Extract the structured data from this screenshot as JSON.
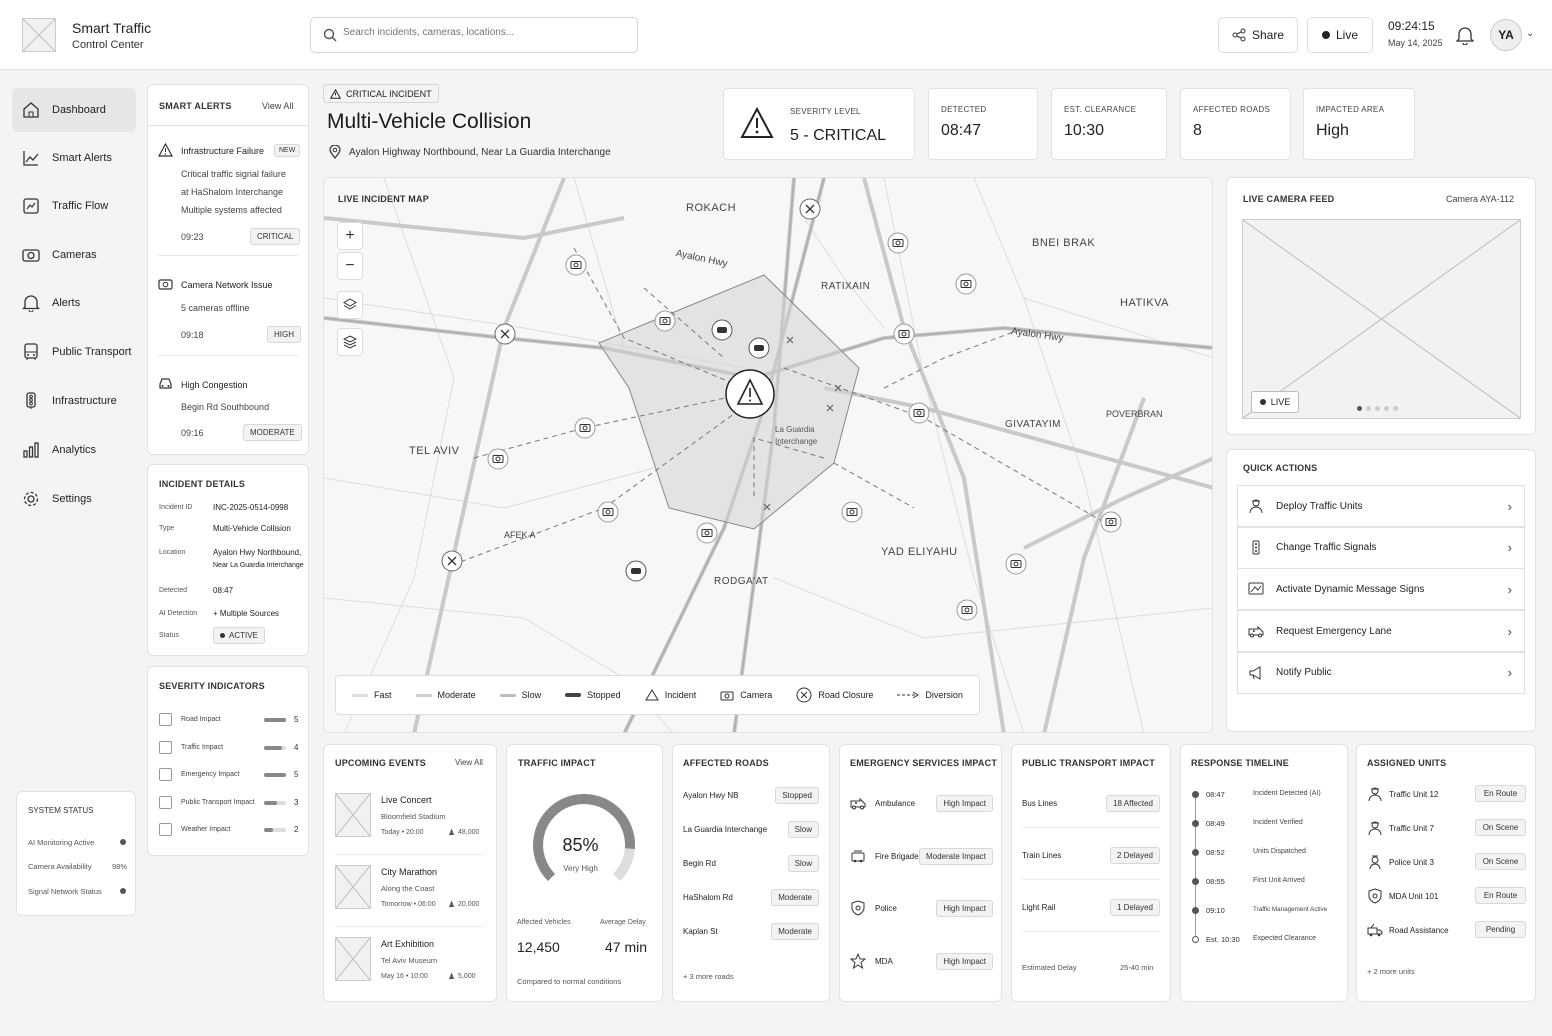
{
  "app": {
    "title": "Smart Traffic",
    "subtitle": "Control Center"
  },
  "search": {
    "placeholder": "Search incidents, cameras, locations..."
  },
  "header": {
    "share_label": "Share",
    "live_label": "Live",
    "time": "09:24:15",
    "date": "May 14, 2025",
    "avatar": "YA"
  },
  "sidebar": {
    "items": [
      {
        "label": "Dashboard",
        "icon": "home-icon"
      },
      {
        "label": "Smart Alerts",
        "icon": "trend-icon"
      },
      {
        "label": "Traffic Flow",
        "icon": "traffic-flow-icon"
      },
      {
        "label": "Cameras",
        "icon": "camera-icon"
      },
      {
        "label": "Alerts",
        "icon": "bell-icon"
      },
      {
        "label": "Public Transport",
        "icon": "bus-icon"
      },
      {
        "label": "Infrastructure",
        "icon": "traffic-light-icon"
      },
      {
        "label": "Analytics",
        "icon": "bar-chart-icon"
      },
      {
        "label": "Settings",
        "icon": "gear-icon"
      }
    ],
    "system_status": {
      "title": "SYSTEM STATUS",
      "rows": [
        {
          "label": "AI Monitoring Active",
          "value": ""
        },
        {
          "label": "Camera Availability",
          "value": "98%"
        },
        {
          "label": "Signal Network Status",
          "value": ""
        }
      ]
    }
  },
  "smart_alerts": {
    "title": "SMART ALERTS",
    "view_all": "View All",
    "items": [
      {
        "title": "Infrastructure Failure",
        "badge": "NEW",
        "lines": [
          "Critical traffic signal failure",
          "at HaShalom Interchange",
          "Multiple systems affected"
        ],
        "time": "09:23",
        "level": "CRITICAL"
      },
      {
        "title": "Camera Network Issue",
        "lines": [
          "5 cameras offline"
        ],
        "time": "09:18",
        "level": "HIGH"
      },
      {
        "title": "High Congestion",
        "lines": [
          "Begin Rd Southbound"
        ],
        "time": "09:16",
        "level": "MODERATE"
      }
    ]
  },
  "incident_details": {
    "title": "INCIDENT DETAILS",
    "rows": [
      {
        "label": "Incident ID",
        "value": "INC-2025-0514-0998"
      },
      {
        "label": "Type",
        "value": "Multi-Vehicle Collision"
      },
      {
        "label": "Location",
        "value": "Ayalon Hwy Northbound,",
        "value2": "Near La Guardia Interchange"
      },
      {
        "label": "Detected",
        "value": "08:47"
      },
      {
        "label": "AI Detection",
        "value": "+ Multiple Sources"
      },
      {
        "label": "Status",
        "value": "ACTIVE"
      }
    ]
  },
  "severity_indicators": {
    "title": "SEVERITY INDICATORS",
    "rows": [
      {
        "label": "Road Impact",
        "value": "5",
        "level": 1.0
      },
      {
        "label": "Traffic Impact",
        "value": "4",
        "level": 0.8
      },
      {
        "label": "Emergency Impact",
        "value": "5",
        "level": 1.0
      },
      {
        "label": "Public Transport Impact",
        "value": "3",
        "level": 0.6
      },
      {
        "label": "Weather Impact",
        "value": "2",
        "level": 0.4
      }
    ]
  },
  "incident": {
    "badge": "CRITICAL INCIDENT",
    "title": "Multi-Vehicle Collision",
    "location": "Ayalon Highway Northbound, Near La Guardia Interchange"
  },
  "stats": {
    "severity": {
      "label": "SEVERITY LEVEL",
      "value": "5 - CRITICAL"
    },
    "detected": {
      "label": "DETECTED",
      "value": "08:47"
    },
    "clearance": {
      "label": "EST. CLEARANCE",
      "value": "10:30"
    },
    "roads": {
      "label": "AFFECTED ROADS",
      "value": "8"
    },
    "area": {
      "label": "IMPACTED AREA",
      "value": "High"
    }
  },
  "map": {
    "title": "LIVE INCIDENT MAP",
    "labels": {
      "rokach": "ROKACH",
      "bnei_brak": "BNEI BRAK",
      "ratixain": "RATIXAIN",
      "hatikva": "HATIKVA",
      "givatayim": "GIVATAYIM",
      "poverbran": "POVERBRAN",
      "tel_aviv": "TEL AVIV",
      "afek": "AFEK A",
      "yad_eliyahu": "YAD ELIYAHU",
      "rodgaat": "RODGA'AT",
      "ayalon1": "Ayalon Hwy",
      "ayalon2": "Ayalon Hwy",
      "guardia1": "La Guardia",
      "guardia2": "Interchange"
    },
    "legend": [
      "Fast",
      "Moderate",
      "Slow",
      "Stopped",
      "Incident",
      "Camera",
      "Road Closure",
      "Diversion"
    ]
  },
  "camera_feed": {
    "title": "LIVE CAMERA FEED",
    "camera": "Camera AYA-112",
    "live": "LIVE"
  },
  "quick_actions": {
    "title": "QUICK ACTIONS",
    "items": [
      {
        "label": "Deploy Traffic Units",
        "icon": "officer-icon"
      },
      {
        "label": "Change Traffic Signals",
        "icon": "traffic-light-icon"
      },
      {
        "label": "Activate Dynamic Message Signs",
        "icon": "sign-icon"
      },
      {
        "label": "Request Emergency Lane",
        "icon": "ambulance-icon"
      },
      {
        "label": "Notify Public",
        "icon": "megaphone-icon"
      }
    ]
  },
  "events": {
    "title": "UPCOMING EVENTS",
    "view_all": "View All",
    "items": [
      {
        "name": "Live Concert",
        "place": "Bloomfield Stadium",
        "when": "Today • 20:00",
        "people": "48,000"
      },
      {
        "name": "City Marathon",
        "place": "Along the Coast",
        "when": "Tomorrow • 06:00",
        "people": "20,000"
      },
      {
        "name": "Art Exhibition",
        "place": "Tel Aviv Museum",
        "when": "May 16 • 10:00",
        "people": "5,000"
      }
    ]
  },
  "traffic_impact": {
    "title": "TRAFFIC IMPACT",
    "percent": "85%",
    "percent_value": 0.85,
    "level": "Very High",
    "vehicles_label": "Affected Vehicles",
    "vehicles": "12,450",
    "delay_label": "Average Delay",
    "delay": "47 min",
    "note": "Compared to normal conditions"
  },
  "affected_roads": {
    "title": "AFFECTED ROADS",
    "rows": [
      {
        "name": "Ayalon Hwy NB",
        "status": "Stopped"
      },
      {
        "name": "La Guardia Interchange",
        "status": "Slow"
      },
      {
        "name": "Begin Rd",
        "status": "Slow"
      },
      {
        "name": "HaShalom Rd",
        "status": "Moderate"
      },
      {
        "name": "Kaplan St",
        "status": "Moderate"
      }
    ],
    "more": "+ 3 more roads"
  },
  "emergency": {
    "title": "EMERGENCY SERVICES IMPACT",
    "rows": [
      {
        "name": "Ambulance",
        "status": "High Impact",
        "icon": "ambulance-icon"
      },
      {
        "name": "Fire Brigade",
        "status": "Moderate Impact",
        "icon": "fire-truck-icon"
      },
      {
        "name": "Police",
        "status": "High Impact",
        "icon": "shield-icon"
      },
      {
        "name": "MDA",
        "status": "High Impact",
        "icon": "star-icon"
      }
    ]
  },
  "transport": {
    "title": "PUBLIC TRANSPORT IMPACT",
    "rows": [
      {
        "name": "Bus Lines",
        "status": "18 Affected"
      },
      {
        "name": "Train Lines",
        "status": "2 Delayed"
      },
      {
        "name": "Light Rail",
        "status": "1 Delayed"
      }
    ],
    "delay_label": "Estimated Delay",
    "delay": "25-40 min"
  },
  "timeline": {
    "title": "RESPONSE TIMELINE",
    "rows": [
      {
        "time": "08:47",
        "event": "Incident Detected (AI)"
      },
      {
        "time": "08:49",
        "event": "Incident Verified"
      },
      {
        "time": "08:52",
        "event": "Units Dispatched"
      },
      {
        "time": "08:55",
        "event": "First Unit Arrived"
      },
      {
        "time": "09:10",
        "event": "Traffic Management Active"
      },
      {
        "time": "Est. 10:30",
        "event": "Expected Clearance"
      }
    ]
  },
  "units": {
    "title": "ASSIGNED UNITS",
    "rows": [
      {
        "name": "Traffic Unit 12",
        "status": "En Route",
        "icon": "officer-icon"
      },
      {
        "name": "Traffic Unit 7",
        "status": "On Scene",
        "icon": "officer-icon"
      },
      {
        "name": "Police Unit 3",
        "status": "On Scene",
        "icon": "badge-icon"
      },
      {
        "name": "MDA Unit 101",
        "status": "En Route",
        "icon": "shield-icon"
      },
      {
        "name": "Road Assistance",
        "status": "Pending",
        "icon": "tow-truck-icon"
      }
    ],
    "more": "+ 2 more units"
  }
}
